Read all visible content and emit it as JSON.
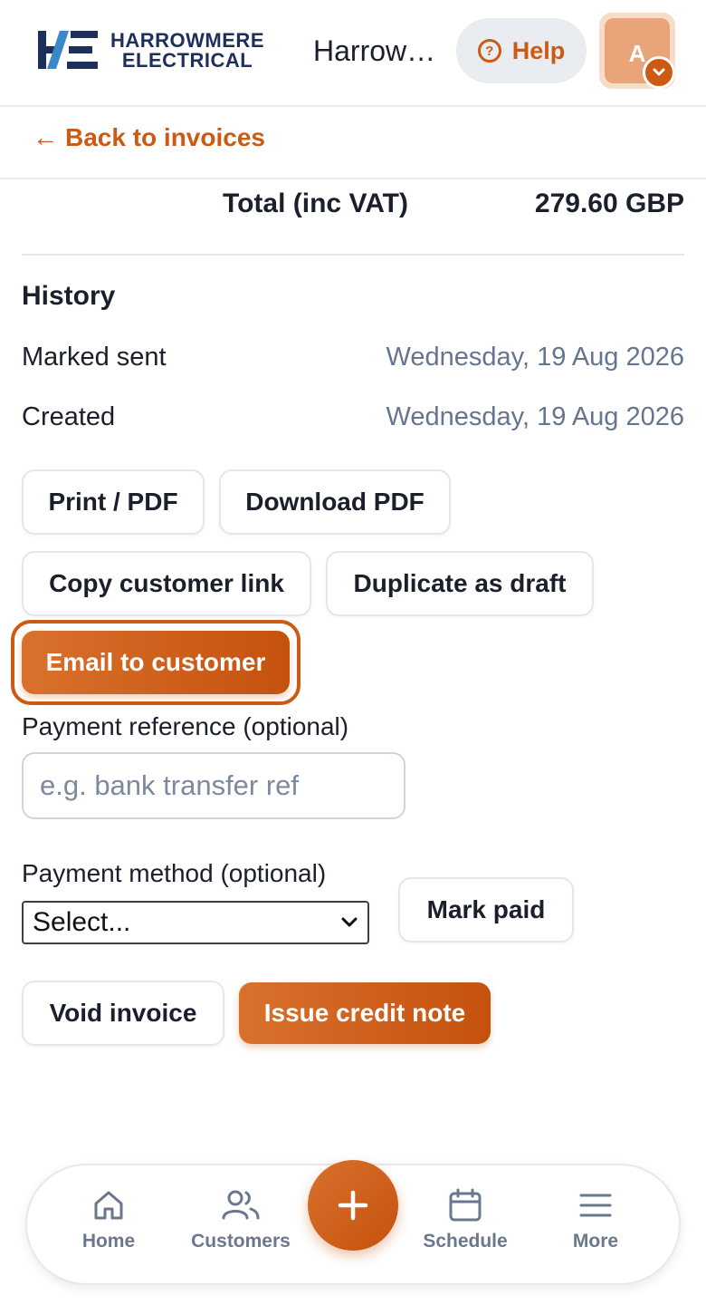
{
  "header": {
    "brand_line1": "HARROWMERE",
    "brand_line2": "ELECTRICAL",
    "org_name": "Harrowmere Electrical",
    "help_label": "Help",
    "avatar_initial": "A",
    "accent_color": "#cc5a12"
  },
  "nav": {
    "back_label": "Back to invoices"
  },
  "totals": {
    "label": "Total (inc VAT)",
    "value": "279.60 GBP"
  },
  "history": {
    "title": "History",
    "rows": [
      {
        "label": "Marked sent",
        "date": "Wednesday, 19 Aug 2026"
      },
      {
        "label": "Created",
        "date": "Wednesday, 19 Aug 2026"
      }
    ]
  },
  "actions": {
    "print_pdf": "Print / PDF",
    "download_pdf": "Download PDF",
    "copy_link": "Copy customer link",
    "duplicate": "Duplicate as draft",
    "email": "Email to customer"
  },
  "payment": {
    "reference_label": "Payment reference (optional)",
    "reference_placeholder": "e.g. bank transfer ref",
    "reference_value": "",
    "method_label": "Payment method (optional)",
    "method_selected": "Select...",
    "mark_paid": "Mark paid"
  },
  "danger": {
    "void": "Void invoice",
    "credit_note": "Issue credit note"
  },
  "bottom_nav": {
    "home": "Home",
    "customers": "Customers",
    "schedule": "Schedule",
    "more": "More"
  }
}
